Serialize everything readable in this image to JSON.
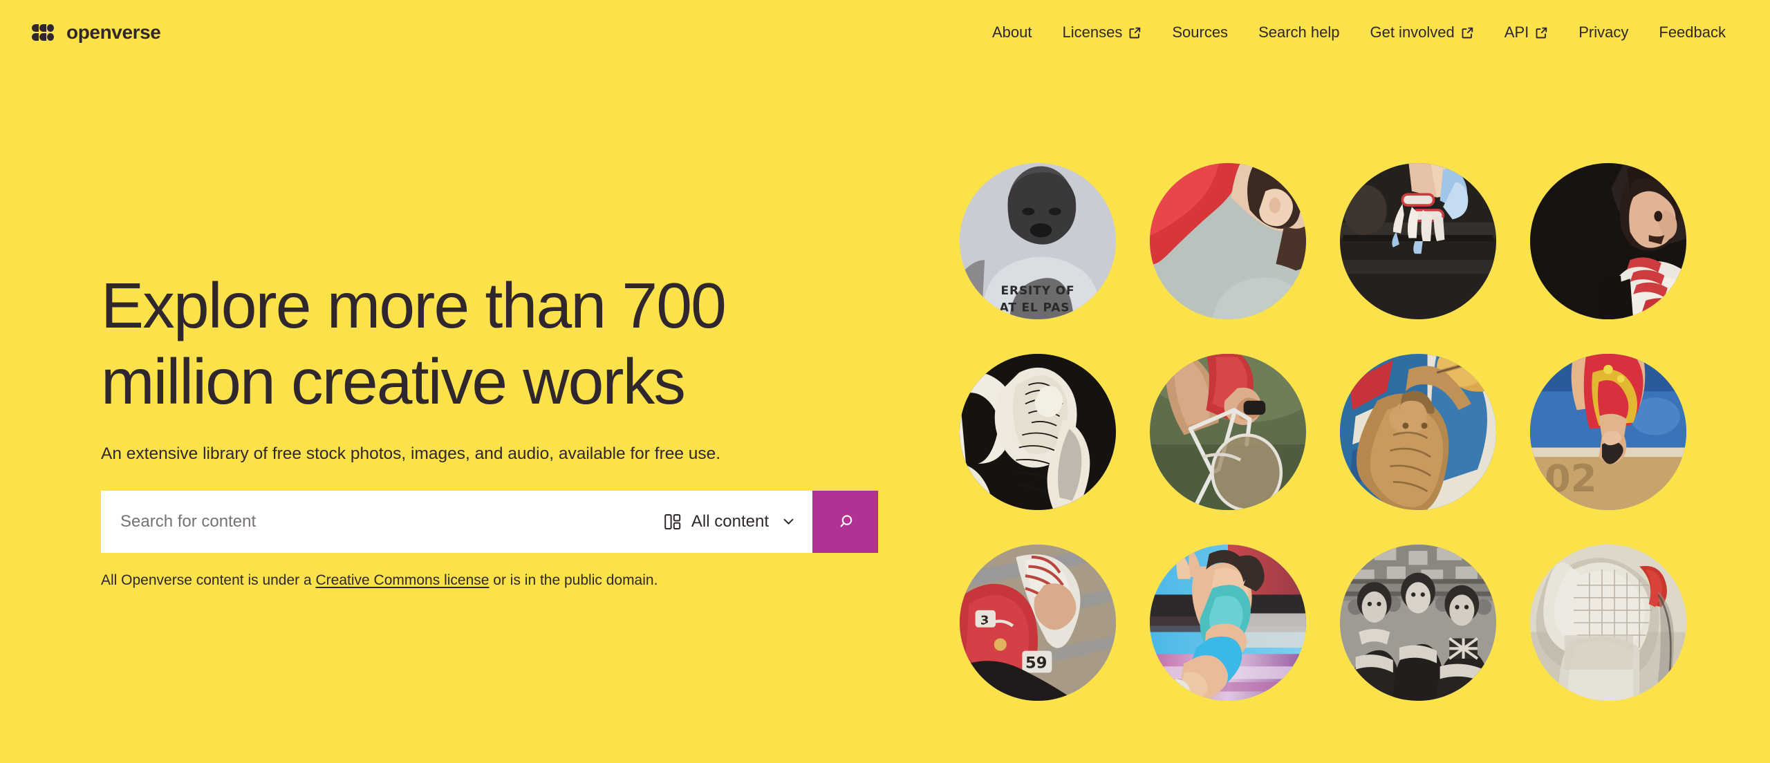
{
  "brand": {
    "name": "openverse",
    "logo_icon": "openverse-logo-mark"
  },
  "nav": {
    "items": [
      {
        "label": "About",
        "external": false,
        "icon": null
      },
      {
        "label": "Licenses",
        "external": true,
        "icon": "external-link-icon"
      },
      {
        "label": "Sources",
        "external": false,
        "icon": null
      },
      {
        "label": "Search help",
        "external": false,
        "icon": null
      },
      {
        "label": "Get involved",
        "external": true,
        "icon": "external-link-icon"
      },
      {
        "label": "API",
        "external": true,
        "icon": "external-link-icon"
      },
      {
        "label": "Privacy",
        "external": false,
        "icon": null
      },
      {
        "label": "Feedback",
        "external": false,
        "icon": null
      }
    ]
  },
  "hero": {
    "headline": "Explore more than 700 million creative works",
    "subheadline": "An extensive library of free stock photos, images, and audio, available for free use."
  },
  "search": {
    "placeholder": "Search for content",
    "value": "",
    "content_type": "All content",
    "content_type_icon": "content-switcher-grid-icon",
    "caret_icon": "chevron-down-icon",
    "submit_icon": "search-icon",
    "submit_label": "Search"
  },
  "license_note": {
    "before": "All Openverse content is under a ",
    "link": "Creative Commons license",
    "after": " or is in the public domain."
  },
  "photos": [
    {
      "alt": "Black and white photo of a basketball player in a University of Texas at El Paso jersey"
    },
    {
      "alt": "Athlete in a red jacket leaning forward, face in profile"
    },
    {
      "alt": "Gymnast's chalked hands gripping the uneven bars"
    },
    {
      "alt": "Weightlifter in a white and red singlet in profile against a dark background"
    },
    {
      "alt": "Black and white engraving of a wrestler or discus thrower"
    },
    {
      "alt": "Track cyclist in red leaning over the handlebars of a white racing bike"
    },
    {
      "alt": "Painted illustration of a javelin thrower with flags in the background"
    },
    {
      "alt": "Gymnast in red and yellow leotard inverted on the balance beam"
    },
    {
      "alt": "Track cyclist in red with helmet and race number 59"
    },
    {
      "alt": "Motion-blurred photo of a female sprinter running on a track"
    },
    {
      "alt": "Vintage black and white photo of three women athletes, one wearing a Union Jack vest"
    },
    {
      "alt": "Fencer in white uniform and mask in profile"
    }
  ],
  "colors": {
    "background": "#fbe14a",
    "text": "#30272e",
    "accent": "#b13293",
    "field_background": "#ffffff",
    "placeholder": "#767175"
  }
}
